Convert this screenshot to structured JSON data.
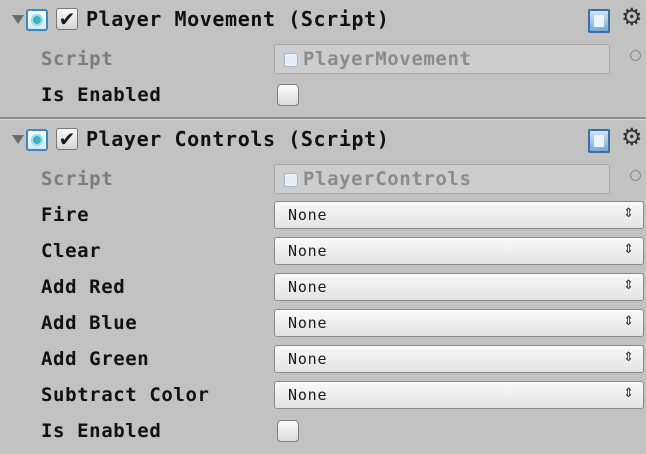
{
  "components": [
    {
      "title": "Player Movement (Script)",
      "enabled": true,
      "script_label": "Script",
      "script_value": "PlayerMovement",
      "is_enabled_label": "Is Enabled"
    },
    {
      "title": "Player Controls (Script)",
      "enabled": true,
      "script_label": "Script",
      "script_value": "PlayerControls",
      "fields": [
        {
          "label": "Fire",
          "value": "None"
        },
        {
          "label": "Clear",
          "value": "None"
        },
        {
          "label": "Add Red",
          "value": "None"
        },
        {
          "label": "Add Blue",
          "value": "None"
        },
        {
          "label": "Add Green",
          "value": "None"
        },
        {
          "label": "Subtract Color",
          "value": "None"
        }
      ],
      "is_enabled_label": "Is Enabled"
    }
  ],
  "icons": {
    "foldout": "triangle-down-icon",
    "script": "script-icon",
    "help": "help-book-icon",
    "settings": "gear-icon",
    "object_picker": "circle-picker-icon",
    "popup_arrows": "up-down-arrows-icon"
  },
  "colors": {
    "background": "#c2c2c2",
    "label_disabled": "#7d7d7d",
    "accent_blue": "#3f86c7"
  }
}
